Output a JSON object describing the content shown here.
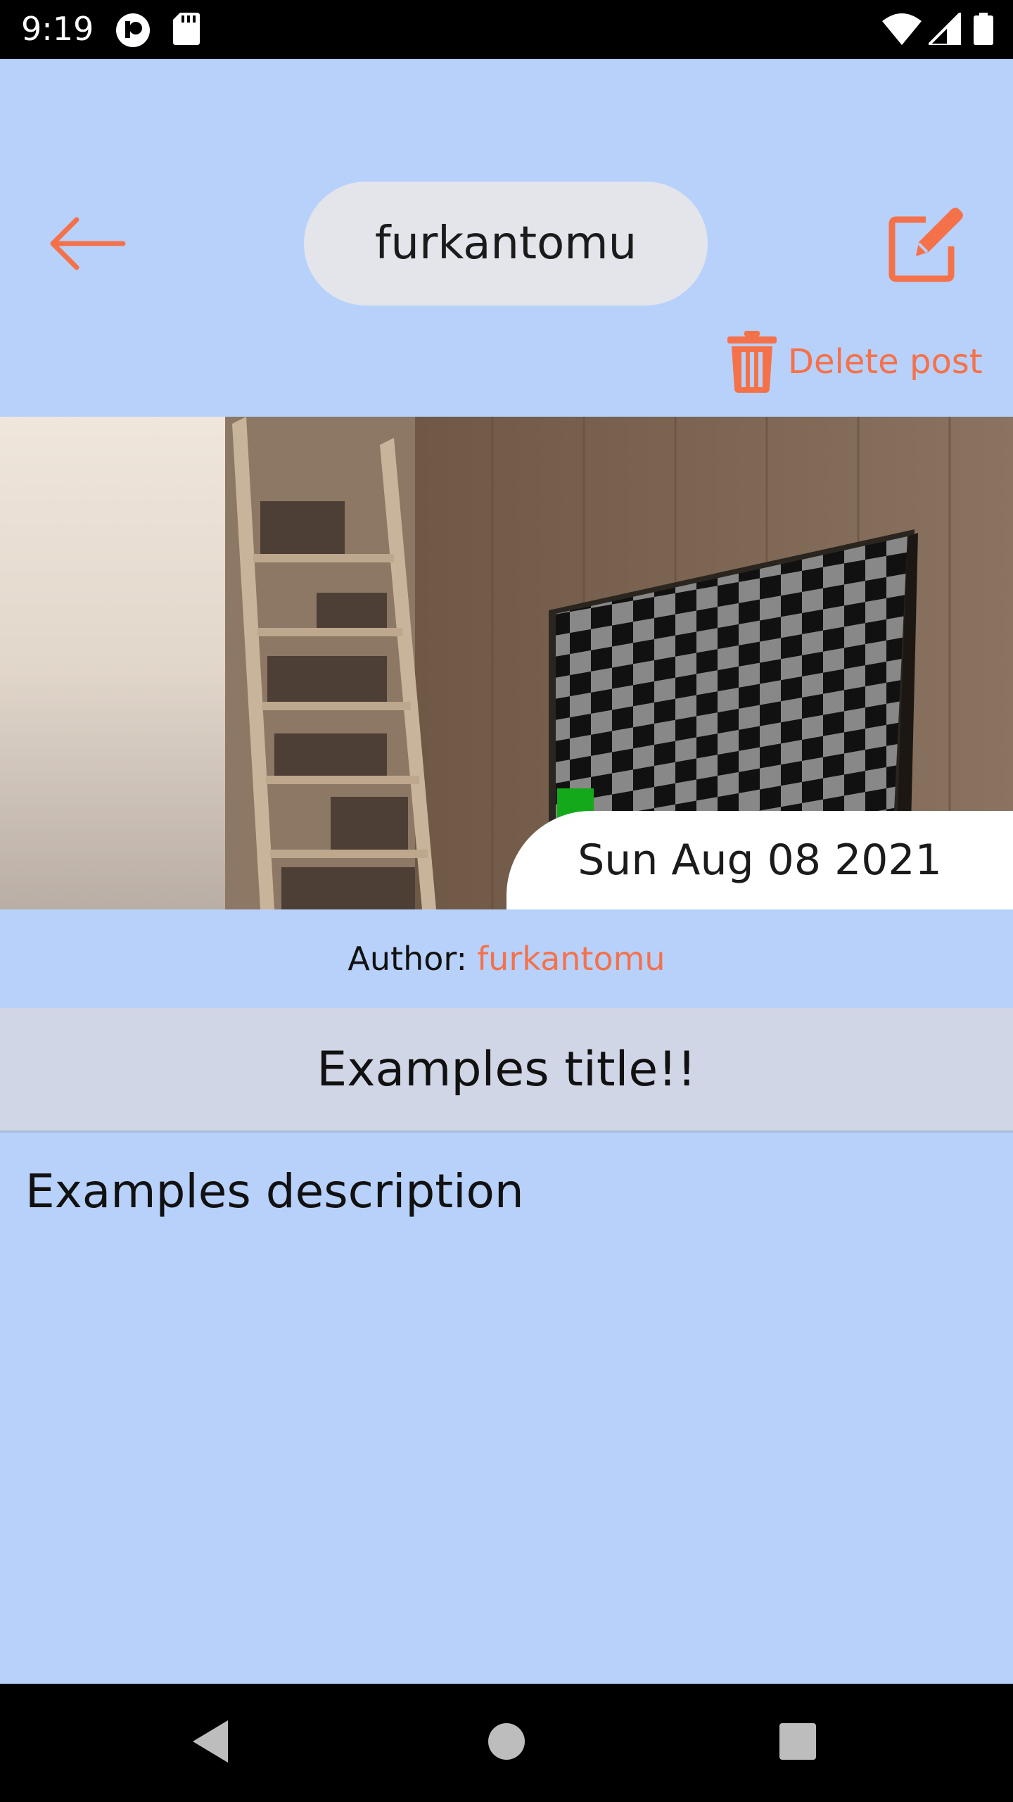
{
  "status_bar": {
    "time": "9:19",
    "icons": [
      "notification-icon",
      "sd-card-icon",
      "wifi-icon",
      "signal-icon",
      "battery-icon"
    ]
  },
  "header": {
    "back_icon": "arrow-left-icon",
    "username": "furkantomu",
    "edit_icon": "edit-icon",
    "delete_label": "Delete post",
    "delete_icon": "trash-icon"
  },
  "post": {
    "date": "Sun Aug 08 2021",
    "author_label": "Author:",
    "author_name": "furkantomu",
    "title": "Examples title!!",
    "description": "Examples description"
  },
  "nav_bar": {
    "icons": [
      "back-triangle-icon",
      "home-circle-icon",
      "recents-square-icon"
    ]
  },
  "colors": {
    "background": "#b8d1fb",
    "accent": "#f5714a",
    "pill": "#e3e5eb",
    "title_bar": "#d1d6e7"
  }
}
